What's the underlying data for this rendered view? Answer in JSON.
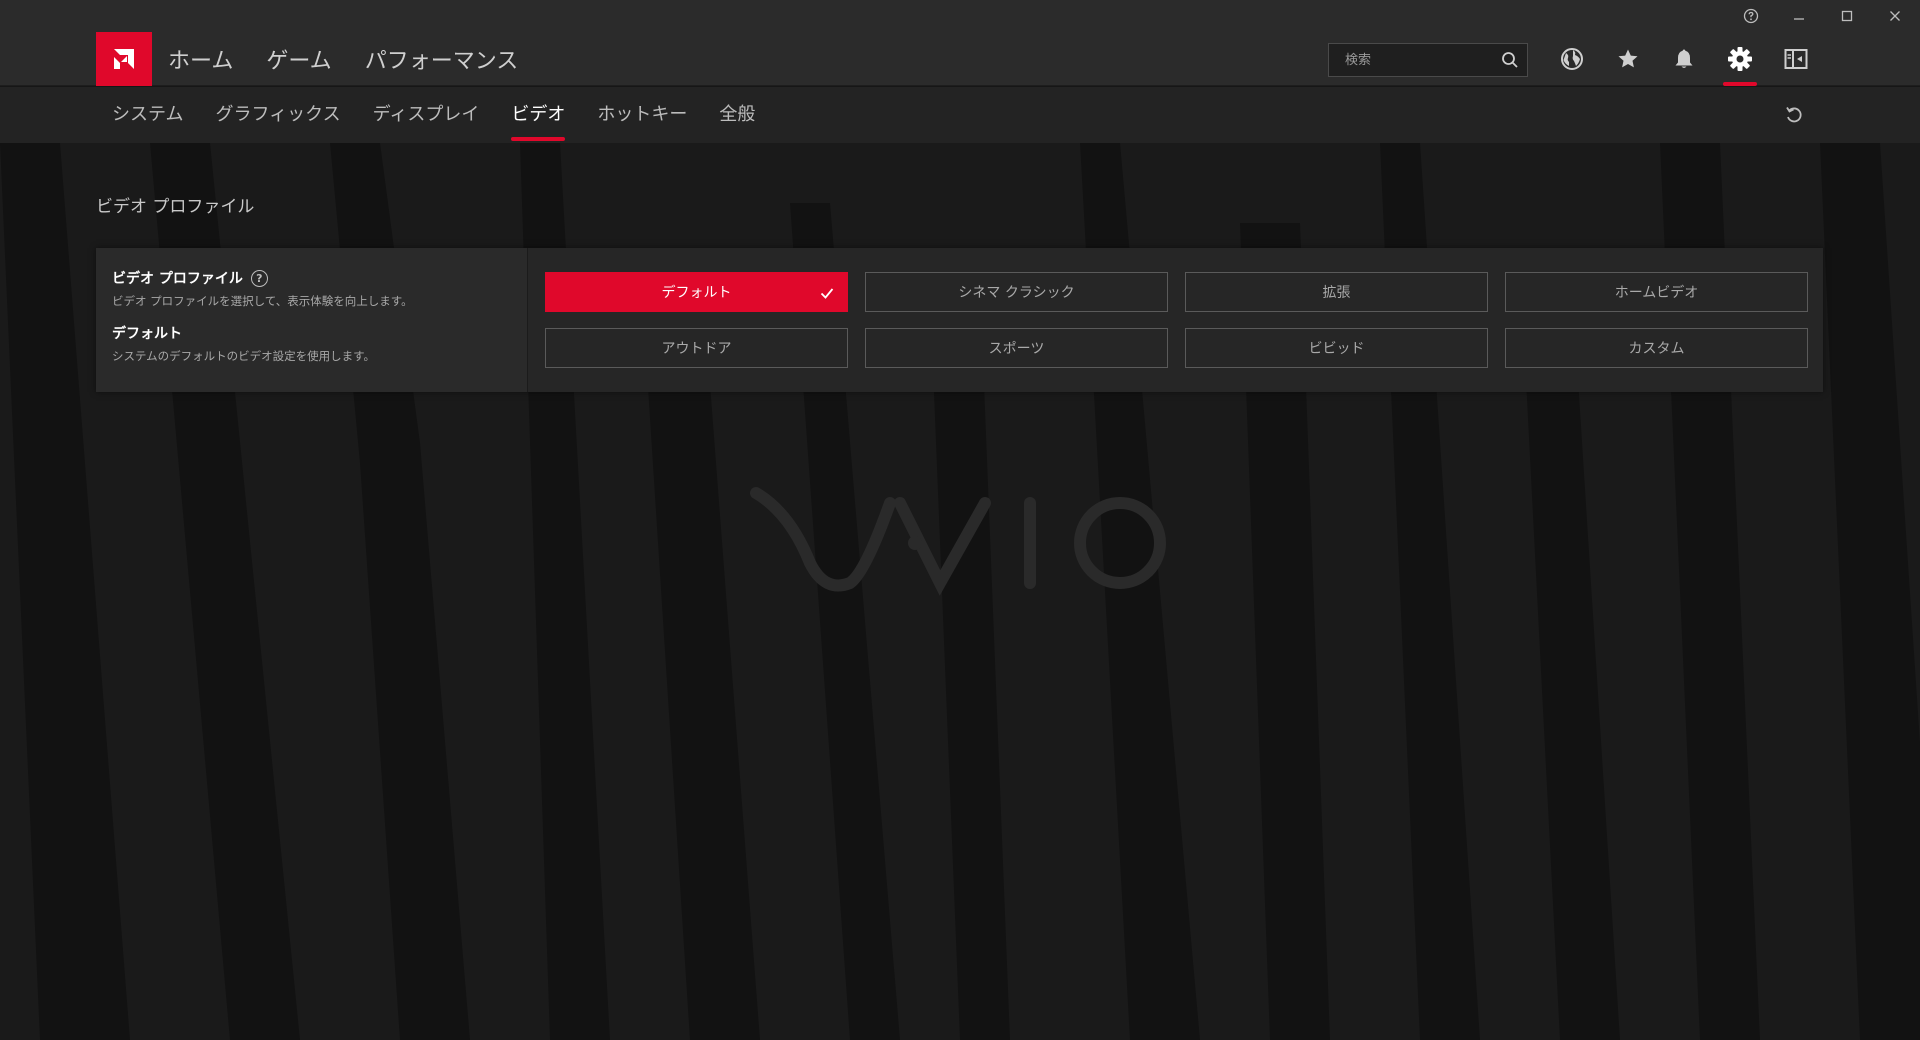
{
  "search": {
    "placeholder": "検索"
  },
  "main_nav": [
    {
      "label": "ホーム"
    },
    {
      "label": "ゲーム"
    },
    {
      "label": "パフォーマンス"
    }
  ],
  "sub_nav": [
    {
      "label": "システム"
    },
    {
      "label": "グラフィックス"
    },
    {
      "label": "ディスプレイ"
    },
    {
      "label": "ビデオ",
      "active": true
    },
    {
      "label": "ホットキー"
    },
    {
      "label": "全般"
    }
  ],
  "section": {
    "title": "ビデオ プロファイル",
    "option_title": "ビデオ プロファイル",
    "option_desc": "ビデオ プロファイルを選択して、表示体験を向上します。",
    "value_title": "デフォルト",
    "value_desc": "システムのデフォルトのビデオ設定を使用します。",
    "help_glyph": "?"
  },
  "presets": [
    {
      "label": "デフォルト",
      "selected": true
    },
    {
      "label": "シネマ クラシック"
    },
    {
      "label": "拡張"
    },
    {
      "label": "ホームビデオ"
    },
    {
      "label": "アウトドア"
    },
    {
      "label": "スポーツ"
    },
    {
      "label": "ビビッド"
    },
    {
      "label": "カスタム"
    }
  ],
  "icons": {
    "logo": "amd-logo-icon",
    "search": "search-icon",
    "globe": "globe-icon",
    "star": "star-icon",
    "bell": "bell-icon",
    "gear": "gear-icon",
    "panel": "layout-panel-icon",
    "reset": "reset-icon"
  },
  "colors": {
    "accent": "#e0082b",
    "bar": "#2b2b2b",
    "subnav": "#232323",
    "background": "#1a1a1a"
  }
}
